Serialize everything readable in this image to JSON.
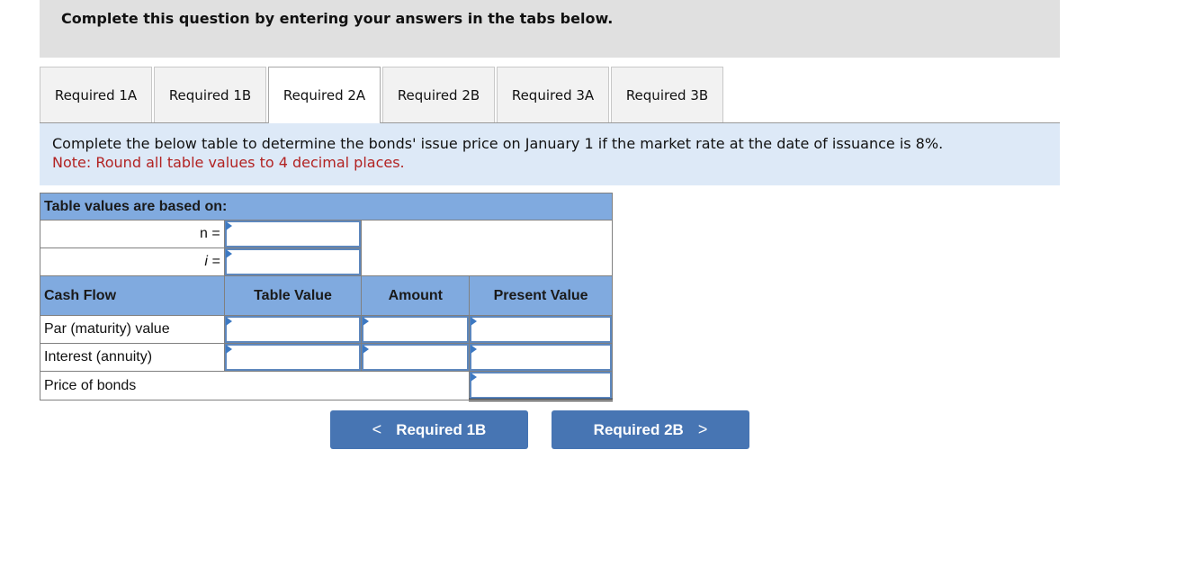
{
  "header": {
    "title": "Complete this question by entering your answers in the tabs below."
  },
  "tabs": [
    {
      "label": "Required 1A",
      "active": false
    },
    {
      "label": "Required 1B",
      "active": false
    },
    {
      "label": "Required 2A",
      "active": true
    },
    {
      "label": "Required 2B",
      "active": false
    },
    {
      "label": "Required 3A",
      "active": false
    },
    {
      "label": "Required 3B",
      "active": false
    }
  ],
  "instructions": {
    "text": "Complete the below table to determine the bonds' issue price on January 1 if the market rate at the date of issuance is 8%.",
    "note": "Note: Round all table values to 4 decimal places."
  },
  "table": {
    "based_on_label": "Table values are based on:",
    "n_label": "n =",
    "i_label": "i =",
    "n_value": "",
    "i_value": "",
    "columns": [
      "Cash Flow",
      "Table Value",
      "Amount",
      "Present Value"
    ],
    "rows": [
      {
        "label": "Par (maturity) value",
        "table_value": "",
        "amount": "",
        "present_value": ""
      },
      {
        "label": "Interest (annuity)",
        "table_value": "",
        "amount": "",
        "present_value": ""
      }
    ],
    "total_label": "Price of bonds",
    "total_value": ""
  },
  "nav": {
    "prev_label": "Required 1B",
    "next_label": "Required 2B",
    "prev_icon": "chevron-left-icon",
    "next_icon": "chevron-right-icon"
  },
  "colors": {
    "header_bg": "#e0e0e0",
    "instruction_bg": "#dde9f7",
    "note_color": "#b22222",
    "table_header_bg": "#80aadf",
    "button_bg": "#4775b3"
  }
}
